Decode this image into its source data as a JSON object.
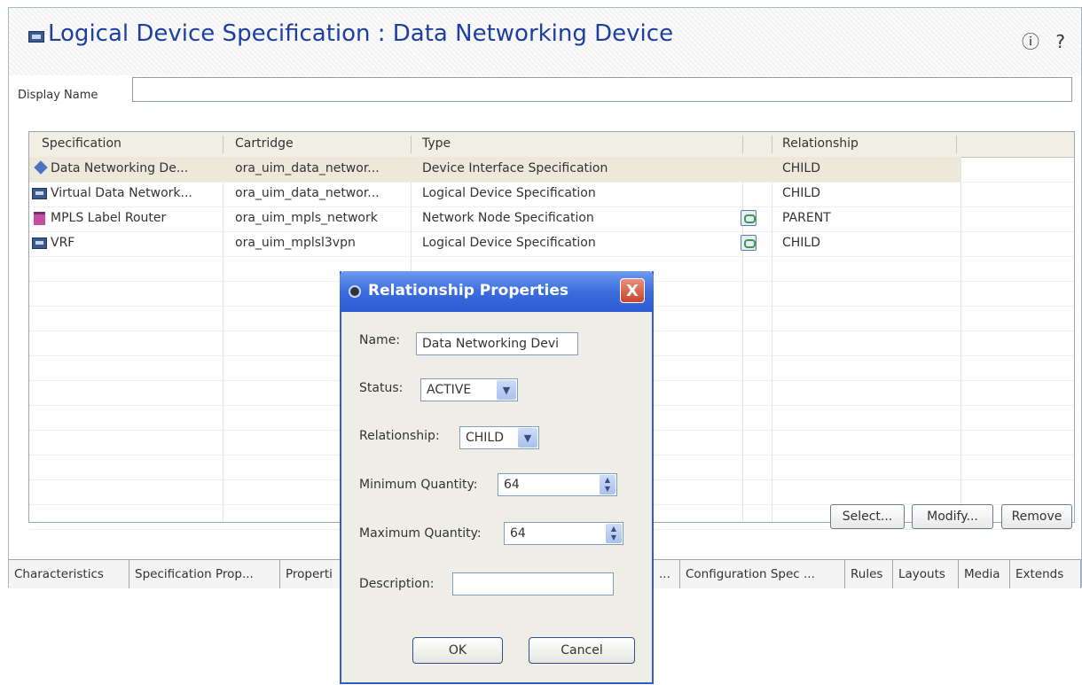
{
  "editor": {
    "title": "Logical Device Specification : Data Networking Device",
    "help_icons": "ⓘ ?",
    "display_name_label": "Display Name",
    "display_name_value": ""
  },
  "table": {
    "columns": [
      "Specification",
      "Cartridge",
      "Type",
      "Relationship"
    ],
    "rows": [
      {
        "icon": "diamond-icon",
        "specification": "Data Networking De...",
        "cartridge": "ora_uim_data_networ...",
        "type": "Device Interface Specification",
        "linked": false,
        "relationship": "CHILD",
        "selected": true
      },
      {
        "icon": "logical-device-icon",
        "specification": "Virtual Data Network...",
        "cartridge": "ora_uim_data_networ...",
        "type": "Logical Device Specification",
        "linked": false,
        "relationship": "CHILD"
      },
      {
        "icon": "network-node-icon",
        "specification": "MPLS Label Router",
        "cartridge": "ora_uim_mpls_network",
        "type": "Network Node Specification",
        "linked": true,
        "relationship": "PARENT"
      },
      {
        "icon": "logical-device-icon",
        "specification": "VRF",
        "cartridge": "ora_uim_mplsl3vpn",
        "type": "Logical Device Specification",
        "linked": true,
        "relationship": "CHILD"
      }
    ]
  },
  "buttons": {
    "select": "Select...",
    "modify": "Modify...",
    "remove": "Remove"
  },
  "tabs": [
    "Characteristics",
    "Specification Prop...",
    "Properti",
    "...",
    "Configuration Spec ...",
    "Rules",
    "Layouts",
    "Media",
    "Extends"
  ],
  "dialog": {
    "title": "Relationship Properties",
    "close": "X",
    "name_label": "Name:",
    "name_value": "Data Networking Devi",
    "status_label": "Status:",
    "status_value": "ACTIVE",
    "relationship_label": "Relationship:",
    "relationship_value": "CHILD",
    "min_label": "Minimum Quantity:",
    "min_value": "64",
    "max_label": "Maximum Quantity:",
    "max_value": "64",
    "description_label": "Description:",
    "description_value": "",
    "ok": "OK",
    "cancel": "Cancel"
  }
}
